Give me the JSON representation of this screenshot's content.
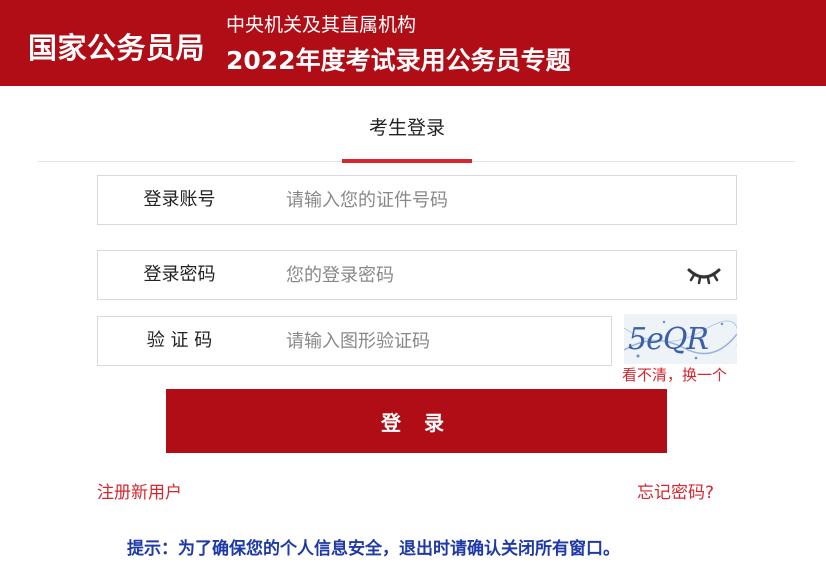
{
  "header": {
    "brand": "国家公务员局",
    "subtitle_line1": "中央机关及其直属机构",
    "subtitle_line2": "2022年度考试录用公务员专题",
    "background_color": "#b00d16"
  },
  "tabs": [
    {
      "label": "考生登录",
      "active": true
    }
  ],
  "form": {
    "account": {
      "label": "登录账号",
      "placeholder": "请输入您的证件号码",
      "value": ""
    },
    "password": {
      "label": "登录密码",
      "placeholder": "您的登录密码",
      "value": "",
      "toggle_icon": "eye-closed-icon"
    },
    "captcha": {
      "label": "验 证 码",
      "placeholder": "请输入图形验证码",
      "value": "",
      "image_text": "5eQR",
      "refresh_label": "看不清，换一个"
    }
  },
  "buttons": {
    "login_label": "登 录"
  },
  "links": {
    "register": "注册新用户",
    "forgot_password": "忘记密码?"
  },
  "tip": "提示：为了确保您的个人信息安全，退出时请确认关闭所有窗口。",
  "colors": {
    "accent": "#b00d16",
    "link": "#d8262f",
    "tip": "#1f3aa6"
  }
}
